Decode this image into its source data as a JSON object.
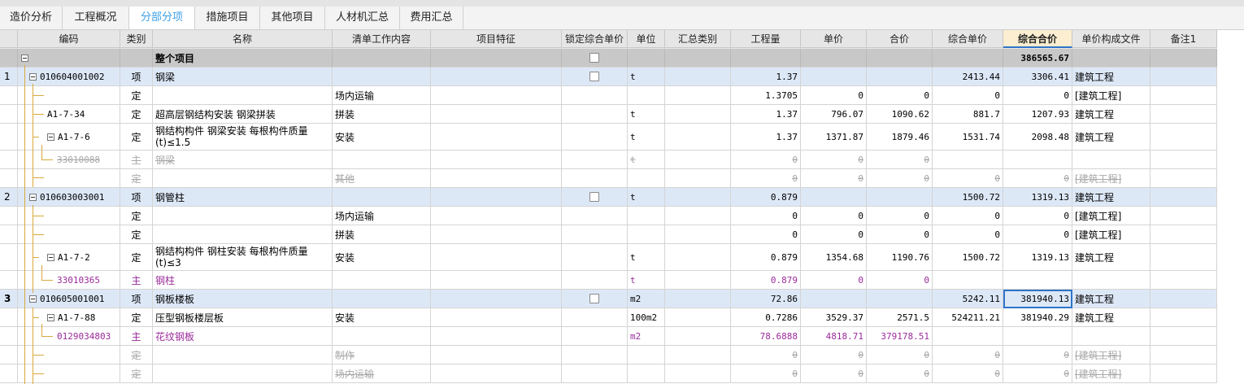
{
  "tabs": [
    "造价分析",
    "工程概况",
    "分部分项",
    "措施项目",
    "其他项目",
    "人材机汇总",
    "费用汇总"
  ],
  "active_tab_index": 2,
  "columns": [
    "编码",
    "类别",
    "名称",
    "清单工作内容",
    "项目特征",
    "锁定综合单价",
    "单位",
    "汇总类别",
    "工程量",
    "单价",
    "合价",
    "综合单价",
    "综合合价",
    "单价构成文件",
    "备注1"
  ],
  "sorted_column": "综合合价",
  "rows": [
    {
      "rownum": "",
      "type": "top",
      "code": "",
      "cat": "",
      "name": "整个项目",
      "work": "",
      "unit": "",
      "qty": "",
      "price": "",
      "total": "",
      "cprice": "",
      "ctotal": "386565.67",
      "file": "",
      "checkbox": true
    },
    {
      "rownum": "1",
      "type": "qd",
      "code": "010604001002",
      "cat": "项",
      "name": "钢梁",
      "work": "",
      "unit": "t",
      "qty": "1.37",
      "price": "",
      "total": "",
      "cprice": "2413.44",
      "ctotal": "3306.41",
      "file": "建筑工程",
      "checkbox": true
    },
    {
      "rownum": "",
      "type": "de",
      "code": "",
      "cat": "定",
      "name": "",
      "work": "场内运输",
      "unit": "",
      "qty": "1.3705",
      "price": "0",
      "total": "0",
      "cprice": "0",
      "ctotal": "0",
      "file": "[建筑工程]"
    },
    {
      "rownum": "",
      "type": "de",
      "code": "A1-7-34",
      "cat": "定",
      "name": "超高层钢结构安装 钢梁拼装",
      "work": "拼装",
      "unit": "t",
      "qty": "1.37",
      "price": "796.07",
      "total": "1090.62",
      "cprice": "881.7",
      "ctotal": "1207.93",
      "file": "建筑工程"
    },
    {
      "rownum": "",
      "type": "de",
      "code": "A1-7-6",
      "cat": "定",
      "name": "钢结构构件 钢梁安装 每根构件质量(t)≤1.5",
      "work": "安装",
      "unit": "t",
      "qty": "1.37",
      "price": "1371.87",
      "total": "1879.46",
      "cprice": "1531.74",
      "ctotal": "2098.48",
      "file": "建筑工程"
    },
    {
      "rownum": "",
      "type": "del",
      "code": "33010088",
      "cat": "主",
      "name": "钢梁",
      "work": "",
      "unit": "t",
      "qty": "0",
      "price": "0",
      "total": "0",
      "cprice": "",
      "ctotal": "",
      "file": ""
    },
    {
      "rownum": "",
      "type": "del",
      "code": "",
      "cat": "定",
      "name": "",
      "work": "其他",
      "unit": "",
      "qty": "0",
      "price": "0",
      "total": "0",
      "cprice": "0",
      "ctotal": "0",
      "file": "[建筑工程]"
    },
    {
      "rownum": "2",
      "type": "qd",
      "code": "010603003001",
      "cat": "项",
      "name": "钢管柱",
      "work": "",
      "unit": "t",
      "qty": "0.879",
      "price": "",
      "total": "",
      "cprice": "1500.72",
      "ctotal": "1319.13",
      "file": "建筑工程",
      "checkbox": true
    },
    {
      "rownum": "",
      "type": "de",
      "code": "",
      "cat": "定",
      "name": "",
      "work": "场内运输",
      "unit": "",
      "qty": "0",
      "price": "0",
      "total": "0",
      "cprice": "0",
      "ctotal": "0",
      "file": "[建筑工程]"
    },
    {
      "rownum": "",
      "type": "de",
      "code": "",
      "cat": "定",
      "name": "",
      "work": "拼装",
      "unit": "",
      "qty": "0",
      "price": "0",
      "total": "0",
      "cprice": "0",
      "ctotal": "0",
      "file": "[建筑工程]"
    },
    {
      "rownum": "",
      "type": "de",
      "code": "A1-7-2",
      "cat": "定",
      "name": "钢结构构件 钢柱安装 每根构件质量(t)≤3",
      "work": "安装",
      "unit": "t",
      "qty": "0.879",
      "price": "1354.68",
      "total": "1190.76",
      "cprice": "1500.72",
      "ctotal": "1319.13",
      "file": "建筑工程"
    },
    {
      "rownum": "",
      "type": "main",
      "code": "33010365",
      "cat": "主",
      "name": "钢柱",
      "work": "",
      "unit": "t",
      "qty": "0.879",
      "price": "0",
      "total": "0",
      "cprice": "",
      "ctotal": "",
      "file": ""
    },
    {
      "rownum": "3",
      "type": "qd",
      "code": "010605001001",
      "cat": "项",
      "name": "钢板楼板",
      "work": "",
      "unit": "m2",
      "qty": "72.86",
      "price": "",
      "total": "",
      "cprice": "5242.11",
      "ctotal": "381940.13",
      "file": "建筑工程",
      "checkbox": true,
      "selected": true
    },
    {
      "rownum": "",
      "type": "de",
      "code": "A1-7-88",
      "cat": "定",
      "name": "压型钢板楼层板",
      "work": "安装",
      "unit": "100m2",
      "qty": "0.7286",
      "price": "3529.37",
      "total": "2571.5",
      "cprice": "524211.21",
      "ctotal": "381940.29",
      "file": "建筑工程"
    },
    {
      "rownum": "",
      "type": "main",
      "code": "0129034803",
      "cat": "主",
      "name": "花纹钢板",
      "work": "",
      "unit": "m2",
      "qty": "78.6888",
      "price": "4818.71",
      "total": "379178.51",
      "cprice": "",
      "ctotal": "",
      "file": ""
    },
    {
      "rownum": "",
      "type": "del",
      "code": "",
      "cat": "定",
      "name": "",
      "work": "制作",
      "unit": "",
      "qty": "0",
      "price": "0",
      "total": "0",
      "cprice": "0",
      "ctotal": "0",
      "file": "[建筑工程]"
    },
    {
      "rownum": "",
      "type": "del",
      "code": "",
      "cat": "定",
      "name": "",
      "work": "场内运输",
      "unit": "",
      "qty": "0",
      "price": "0",
      "total": "0",
      "cprice": "0",
      "ctotal": "0",
      "file": "[建筑工程]"
    }
  ]
}
